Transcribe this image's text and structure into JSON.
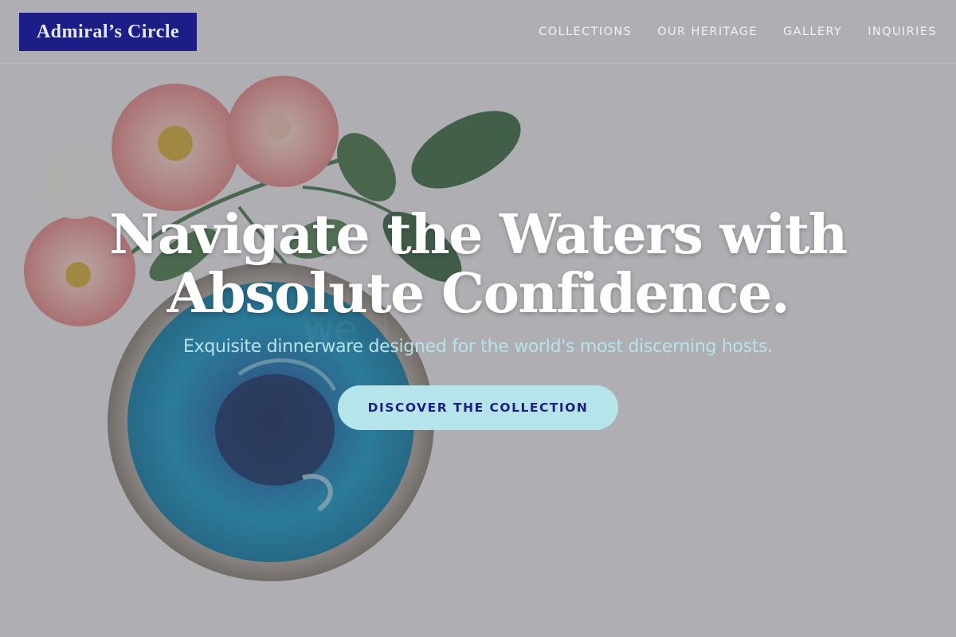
{
  "header": {
    "logo_text": "Admiral’s Circle",
    "nav": [
      {
        "label": "COLLECTIONS"
      },
      {
        "label": "OUR HERITAGE"
      },
      {
        "label": "GALLERY"
      },
      {
        "label": "INQUIRIES"
      }
    ]
  },
  "hero": {
    "title_line1": "Navigate the Waters with",
    "title_line2": "Absolute Confidence.",
    "subtitle": "Exquisite dinnerware designed for the world's most discerning hosts.",
    "cta_label": "DISCOVER THE COLLECTION"
  },
  "colors": {
    "logo_bg": "#1c1d86",
    "cta_bg": "#b5e4ea",
    "cta_text": "#1c1f84",
    "subtitle_text": "#b7e3ea"
  }
}
